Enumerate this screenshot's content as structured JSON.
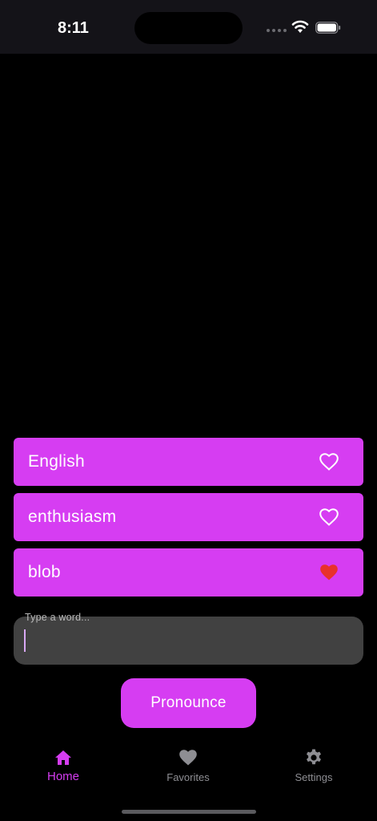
{
  "status_bar": {
    "time": "8:11"
  },
  "words": [
    {
      "text": "English",
      "favorited": false
    },
    {
      "text": "enthusiasm",
      "favorited": false
    },
    {
      "text": "blob",
      "favorited": true
    }
  ],
  "input": {
    "label": "Type a word...",
    "value": ""
  },
  "pronounce_button": {
    "label": "Pronounce"
  },
  "tabs": [
    {
      "label": "Home",
      "icon": "home-icon",
      "active": true
    },
    {
      "label": "Favorites",
      "icon": "heart-icon",
      "active": false
    },
    {
      "label": "Settings",
      "icon": "gear-icon",
      "active": false
    }
  ],
  "colors": {
    "accent": "#d63df2",
    "favorite": "#e8312c",
    "input_bg": "#414141",
    "inactive_tab": "#8e8e93"
  }
}
